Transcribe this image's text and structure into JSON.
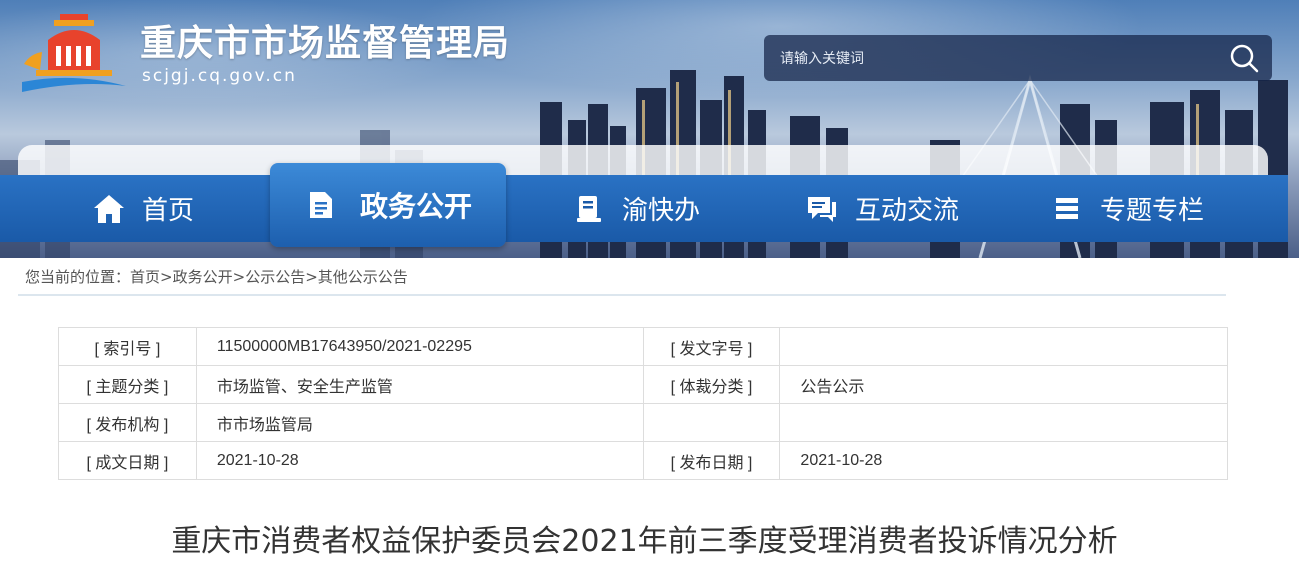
{
  "header": {
    "title": "重庆市市场监督管理局",
    "domain": "scjgj.cq.gov.cn",
    "logo_icon": "city-hall-logo-icon"
  },
  "search": {
    "placeholder": "请输入关键词",
    "icon": "search-icon"
  },
  "nav": {
    "items": [
      {
        "label": "首页",
        "icon": "home-icon"
      },
      {
        "label": "政务公开",
        "icon": "document-icon",
        "active": true
      },
      {
        "label": "渝快办",
        "icon": "book-icon"
      },
      {
        "label": "互动交流",
        "icon": "chat-icon"
      },
      {
        "label": "专题专栏",
        "icon": "list-icon"
      }
    ]
  },
  "breadcrumb": {
    "prefix": "您当前的位置：",
    "items": [
      "首页",
      "政务公开",
      "公示公告",
      "其他公示公告"
    ],
    "separator": ">"
  },
  "info_table": {
    "rows": [
      {
        "k1": "[ 索引号 ]",
        "v1": "11500000MB17643950/2021-02295",
        "k2": "[ 发文字号 ]",
        "v2": ""
      },
      {
        "k1": "[ 主题分类 ]",
        "v1": "市场监管、安全生产监管",
        "k2": "[ 体裁分类 ]",
        "v2": "公告公示"
      },
      {
        "k1": "[ 发布机构 ]",
        "v1": "市市场监管局",
        "k2": "",
        "v2": ""
      },
      {
        "k1": "[ 成文日期 ]",
        "v1": "2021-10-28",
        "k2": "[ 发布日期 ]",
        "v2": "2021-10-28"
      }
    ]
  },
  "article": {
    "title": "重庆市消费者权益保护委员会2021年前三季度受理消费者投诉情况分析"
  },
  "colors": {
    "nav_blue": "#1a5aa8",
    "nav_active": "#2a72c4",
    "text": "#333333"
  }
}
